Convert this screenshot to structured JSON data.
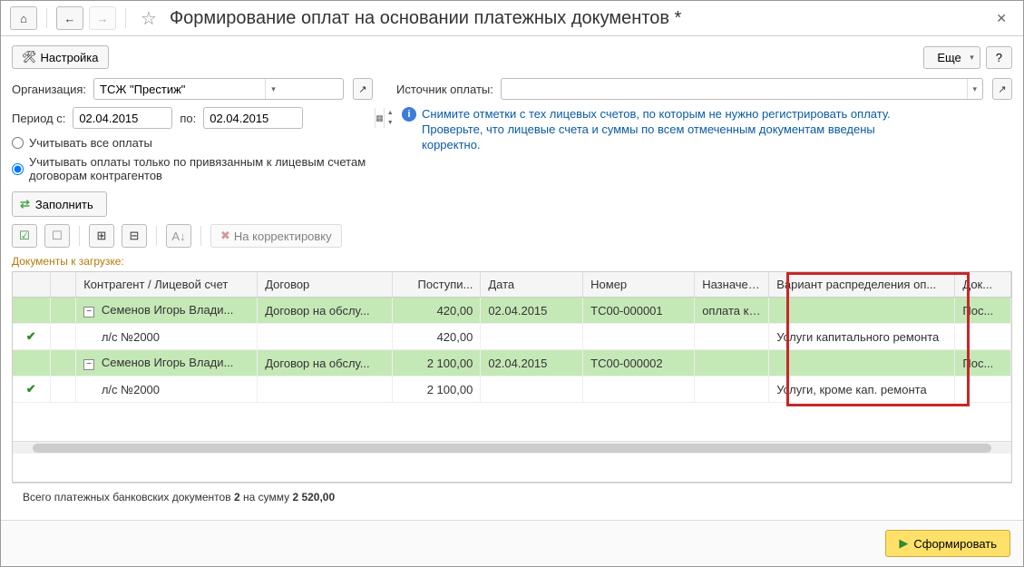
{
  "title": "Формирование оплат на основании платежных документов *",
  "toolbar_top": {
    "settings": "Настройка",
    "more": "Еще",
    "help": "?"
  },
  "fields": {
    "org_label": "Организация:",
    "org_value": "ТСЖ \"Престиж\"",
    "source_label": "Источник оплаты:",
    "source_value": ""
  },
  "period": {
    "from_label": "Период с:",
    "from_value": "02.04.2015",
    "to_label": "по:",
    "to_value": "02.04.2015"
  },
  "info_text": "Снимите отметки с тех лицевых счетов, по которым не нужно регистрировать оплату. Проверьте, что лицевые счета и суммы по всем отмеченным документам введены корректно.",
  "radio": {
    "all": "Учитывать все оплаты",
    "linked": "Учитывать оплаты только по привязанным к лицевым счетам договорам контрагентов"
  },
  "fill_btn": "Заполнить",
  "correction_btn": "На корректировку",
  "section_label": "Документы к загрузке:",
  "columns": {
    "c0": "",
    "c1": "",
    "c2": "Контрагент / Лицевой счет",
    "c3": "Договор",
    "c4": "Поступи...",
    "c5": "Дата",
    "c6": "Номер",
    "c7": "Назначен...",
    "c8": "Вариант распределения оп...",
    "c9": "Док..."
  },
  "rows": [
    {
      "green": true,
      "check": "",
      "idx": "",
      "name": "Семенов Игорь Влади...",
      "contract": "Договор на обслу...",
      "amount": "420,00",
      "date": "02.04.2015",
      "number": "ТС00-000001",
      "desc": "оплата ка...",
      "variant": "",
      "doc": "Пос...",
      "expandable": true
    },
    {
      "green": false,
      "check": "✔",
      "idx": "",
      "name": "л/с №2000",
      "contract": "",
      "amount": "420,00",
      "date": "",
      "number": "",
      "desc": "",
      "variant": "Услуги капитального ремонта",
      "doc": ""
    },
    {
      "green": true,
      "check": "",
      "idx": "",
      "name": "Семенов Игорь Влади...",
      "contract": "Договор на обслу...",
      "amount": "2 100,00",
      "date": "02.04.2015",
      "number": "ТС00-000002",
      "desc": "",
      "variant": "",
      "doc": "Пос...",
      "expandable": true
    },
    {
      "green": false,
      "check": "✔",
      "idx": "",
      "name": "л/с №2000",
      "contract": "",
      "amount": "2 100,00",
      "date": "",
      "number": "",
      "desc": "",
      "variant": "Услуги, кроме кап. ремонта",
      "doc": ""
    }
  ],
  "summary": {
    "prefix": "Всего платежных банковских документов ",
    "count": "2",
    "mid": " на сумму ",
    "sum": "2 520,00"
  },
  "footer": {
    "form": "Сформировать"
  }
}
